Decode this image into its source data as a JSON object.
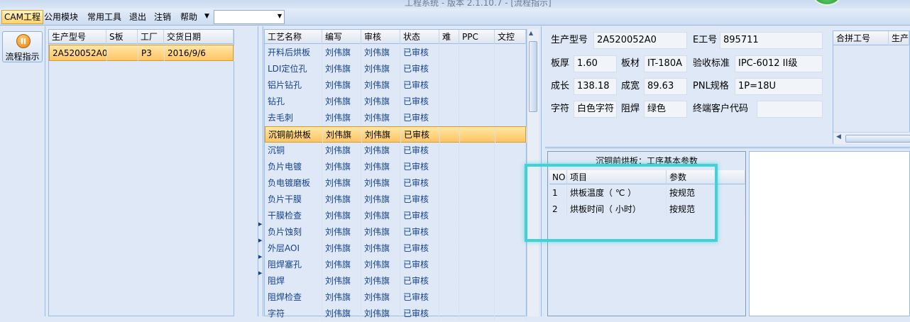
{
  "titlebar": {
    "title": "工程系统 - 版本 2.1.10.7 - [流程指示]"
  },
  "menu": {
    "items": [
      {
        "label": "CAM工程",
        "active": true
      },
      {
        "label": "公用模块"
      },
      {
        "label": "常用工具"
      },
      {
        "label": "退出"
      },
      {
        "label": "注销"
      },
      {
        "label": "帮助"
      }
    ],
    "combo_value": ""
  },
  "left": {
    "flow_button": "流程指示"
  },
  "orders": {
    "columns": [
      "生产型号",
      "S板",
      "工厂",
      "交货日期"
    ],
    "rows": [
      {
        "model": "2A520052A0",
        "s": "",
        "factory": "P3",
        "date": "2016/9/6"
      }
    ]
  },
  "processes": {
    "columns": [
      "工艺名称",
      "编写",
      "审核",
      "状态",
      "难",
      "PPC",
      "文控"
    ],
    "rows": [
      {
        "name": "开料后烘板",
        "writer": "刘伟旗",
        "reviewer": "刘伟旗",
        "status": "已审核"
      },
      {
        "name": "LDI定位孔",
        "writer": "刘伟旗",
        "reviewer": "刘伟旗",
        "status": "已审核"
      },
      {
        "name": "铝片钻孔",
        "writer": "刘伟旗",
        "reviewer": "刘伟旗",
        "status": "已审核"
      },
      {
        "name": "钻孔",
        "writer": "刘伟旗",
        "reviewer": "刘伟旗",
        "status": "已审核"
      },
      {
        "name": "去毛刺",
        "writer": "刘伟旗",
        "reviewer": "刘伟旗",
        "status": "已审核"
      },
      {
        "name": "沉铜前烘板",
        "writer": "刘伟旗",
        "reviewer": "刘伟旗",
        "status": "已审核",
        "selected": true
      },
      {
        "name": "沉铜",
        "writer": "刘伟旗",
        "reviewer": "刘伟旗",
        "status": "已审核"
      },
      {
        "name": "负片电镀",
        "writer": "刘伟旗",
        "reviewer": "刘伟旗",
        "status": "已审核"
      },
      {
        "name": "负电镀磨板",
        "writer": "刘伟旗",
        "reviewer": "刘伟旗",
        "status": "已审核"
      },
      {
        "name": "负片干膜",
        "writer": "刘伟旗",
        "reviewer": "刘伟旗",
        "status": "已审核"
      },
      {
        "name": "干膜检查",
        "writer": "刘伟旗",
        "reviewer": "刘伟旗",
        "status": "已审核"
      },
      {
        "name": "负片蚀刻",
        "writer": "刘伟旗",
        "reviewer": "刘伟旗",
        "status": "已审核"
      },
      {
        "name": "外层AOI",
        "writer": "刘伟旗",
        "reviewer": "刘伟旗",
        "status": "已审核"
      },
      {
        "name": "阻焊塞孔",
        "writer": "刘伟旗",
        "reviewer": "刘伟旗",
        "status": "已审核"
      },
      {
        "name": "阻焊",
        "writer": "刘伟旗",
        "reviewer": "刘伟旗",
        "status": "已审核"
      },
      {
        "name": "阻焊检查",
        "writer": "刘伟旗",
        "reviewer": "刘伟旗",
        "status": "已审核"
      },
      {
        "name": "字符",
        "writer": "刘伟旗",
        "reviewer": "刘伟旗",
        "status": "已审核"
      }
    ]
  },
  "info": {
    "model_label": "生产型号",
    "model_value": "2A520052A0",
    "eno_label": "E工号",
    "eno_value": "895711",
    "thickness_label": "板厚",
    "thickness_value": "1.60",
    "material_label": "板材",
    "material_value": "IT-180A",
    "standard_label": "验收标准",
    "standard_value": "IPC-6012 II级",
    "length_label": "成长",
    "length_value": "138.18",
    "width_label": "成宽",
    "width_value": "89.63",
    "pnl_label": "PNL规格",
    "pnl_value": "1P=18U",
    "char_label": "字符",
    "char_value": "白色字符",
    "mask_label": "阻焊",
    "mask_value": "绿色",
    "customer_label": "终端客户代码",
    "customer_value": ""
  },
  "merge": {
    "columns": [
      "合拼工号",
      "生产"
    ]
  },
  "params": {
    "title": "沉铜前烘板：工序基本参数",
    "columns": [
      "NO",
      "项目",
      "参数"
    ],
    "rows": [
      {
        "no": "1",
        "item": "烘板温度（ ℃ ）",
        "value": "按规范"
      },
      {
        "no": "2",
        "item": "烘板时间（ 小时）",
        "value": "按规范"
      }
    ]
  },
  "colors": {
    "selection": "#ffc564",
    "highlight": "#3fd3d8",
    "text": "#15428b"
  }
}
